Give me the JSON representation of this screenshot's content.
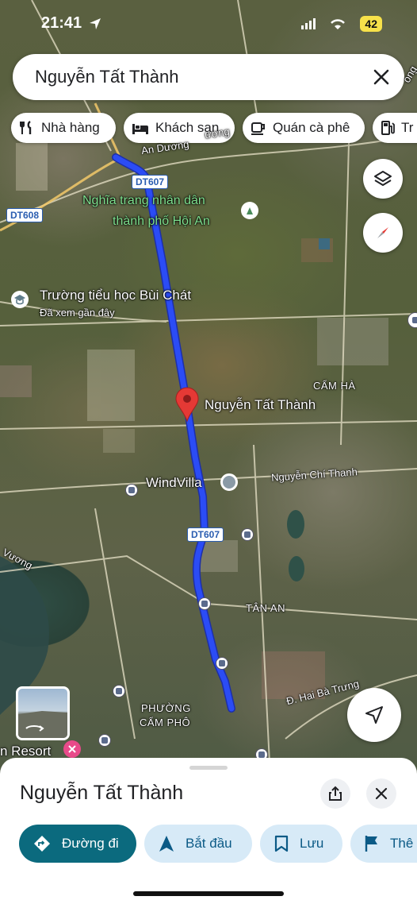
{
  "status_bar": {
    "time": "21:41",
    "battery": "42"
  },
  "search": {
    "query": "Nguyễn Tất Thành"
  },
  "categories": [
    {
      "label": "Nhà hàng",
      "icon": "fork-knife-icon"
    },
    {
      "label": "Khách sạn",
      "icon": "bed-icon"
    },
    {
      "label": "Quán cà phê",
      "icon": "coffee-cup-icon"
    },
    {
      "label": "Tr",
      "icon": "gas-pump-icon"
    }
  ],
  "map": {
    "labels": {
      "road_top": "An Dương",
      "road_top_suffix": "ương",
      "cemetery_1": "Nghĩa trang nhân dân",
      "cemetery_2": "thành phố Hội An",
      "school": "Trường tiểu học Bùi Chát",
      "school_sub": "Đã xem gần đây",
      "cam_ha": "CẨM HÀ",
      "pin": "Nguyễn Tất Thành",
      "windvilla": "WindVilla",
      "nguyen_chi_thanh": "Nguyễn Chí Thanh",
      "vuong": "Vương",
      "tan_an": "TÂN AN",
      "hai_ba_trung": "Đ. Hai Bà Trưng",
      "phuong_1": "PHƯỜNG",
      "phuong_2": "CẨM PHÔ",
      "resort": "n Resort",
      "road_right_top": "ong"
    },
    "shields": [
      "DT607",
      "DT608",
      "DT607"
    ],
    "colors": {
      "route": "#2b4cf5",
      "pin": "#e53935"
    }
  },
  "sheet": {
    "title": "Nguyễn Tất Thành",
    "actions": [
      {
        "label": "Đường đi",
        "icon": "directions-icon"
      },
      {
        "label": "Bắt đầu",
        "icon": "navigation-arrow-icon"
      },
      {
        "label": "Lưu",
        "icon": "bookmark-icon"
      },
      {
        "label": "Thê",
        "icon": "flag-icon"
      }
    ]
  }
}
